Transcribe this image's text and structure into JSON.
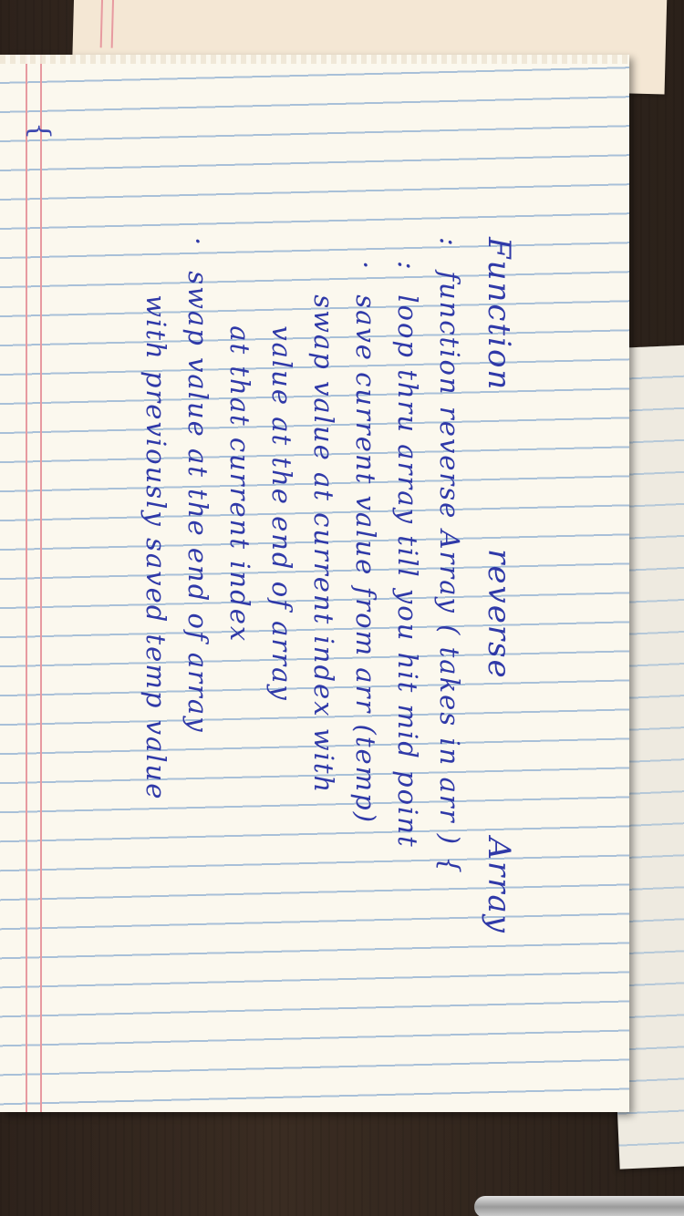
{
  "title": "Function reverse Array",
  "lines": [
    "function      reverse Array ( takes in arr ) {",
    "loop  thru array till you hit mid point",
    "save  current value  from  arr (temp)",
    "swap  value  at  current  index  with",
    "value  at  the  end  of  array",
    "at  that  current  index",
    "swap  value  at  the  end  of  array",
    "with  previously  saved  temp  value"
  ],
  "bullets": [
    ":",
    ":",
    "·",
    "",
    "",
    "",
    "·",
    ""
  ],
  "brace": "{"
}
